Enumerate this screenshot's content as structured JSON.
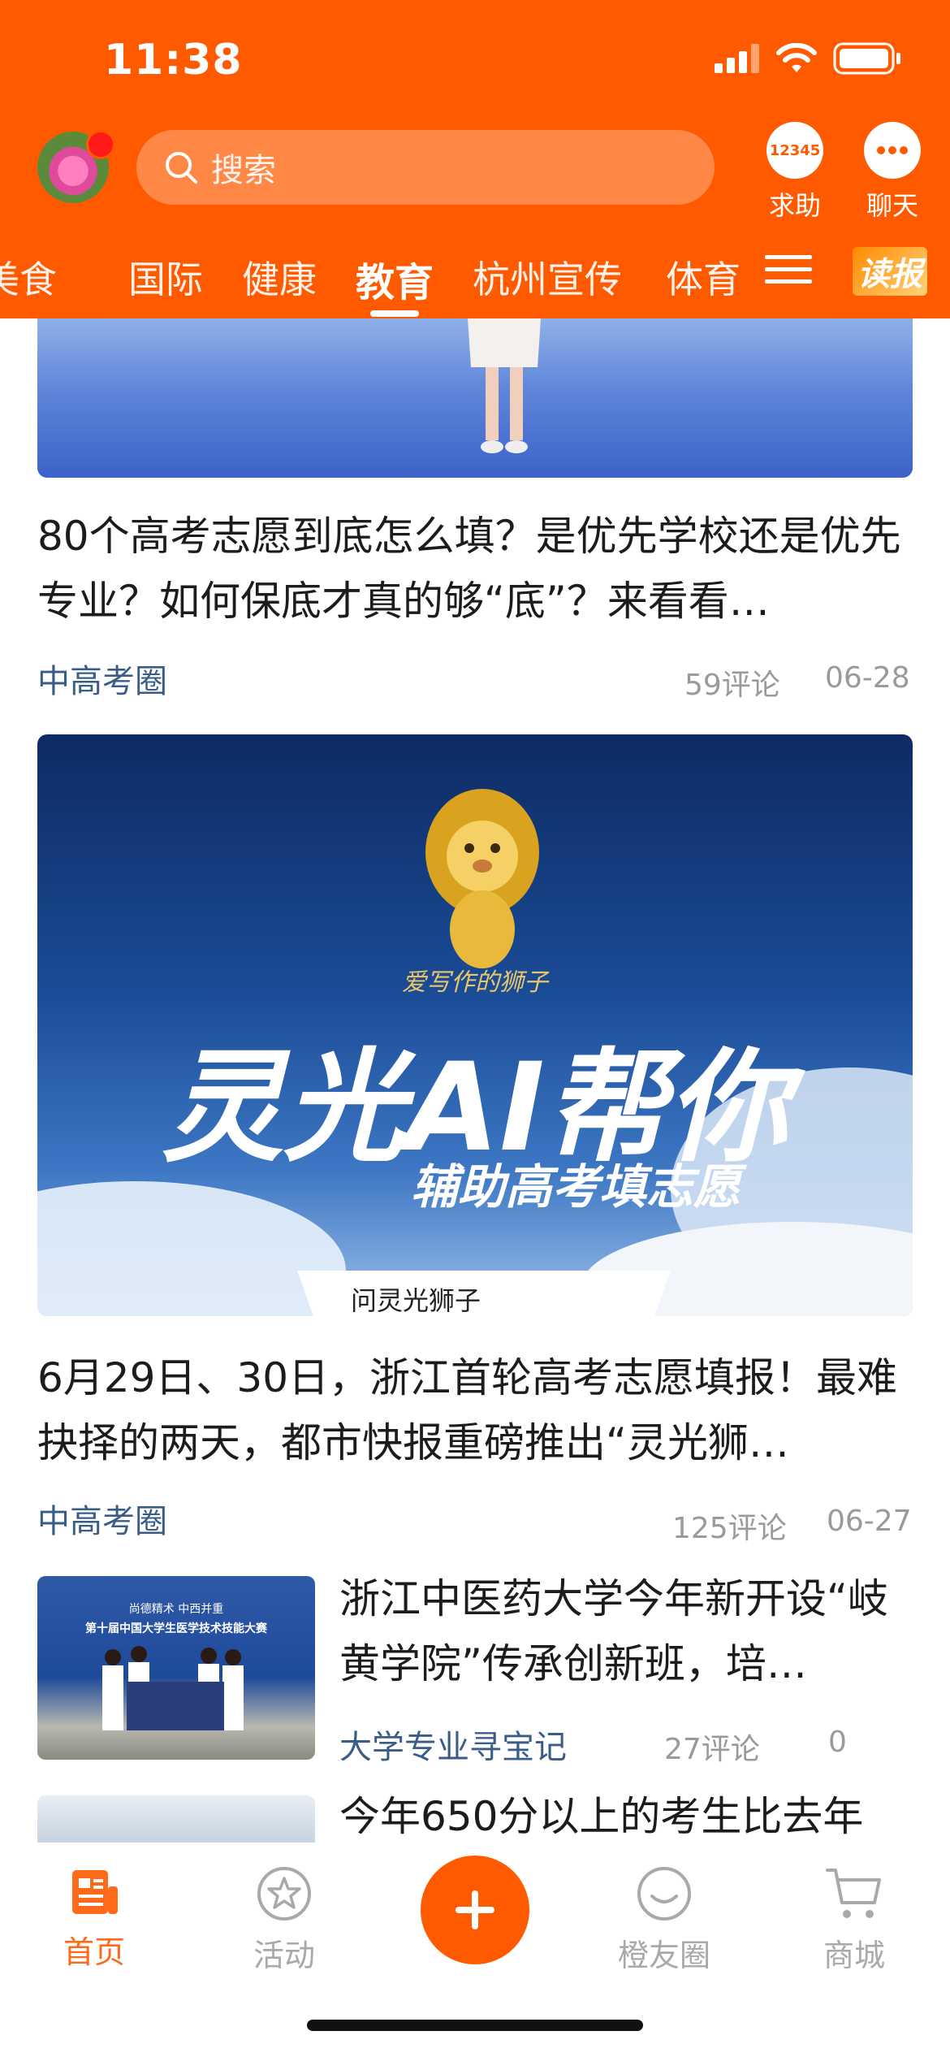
{
  "status": {
    "time": "11:38"
  },
  "header": {
    "search_placeholder": "搜索",
    "help_label": "求助",
    "help_badge": "12345",
    "chat_label": "聊天"
  },
  "tabs": [
    "美食",
    "国际",
    "健康",
    "教育",
    "杭州宣传",
    "体育"
  ],
  "active_tab": "教育",
  "dubao_label": "读报",
  "articles": [
    {
      "title": "80个高考志愿到底怎么填？是优先学校还是优先专业？如何保底才真的够“底”？来看看…",
      "source": "中高考圈",
      "comments": "59评论",
      "date": "06-28"
    },
    {
      "title": "6月29日、30日，浙江首轮高考志愿填报！最难抉择的两天，都市快报重磅推出“灵光狮…",
      "source": "中高考圈",
      "comments": "125评论",
      "date": "06-27",
      "image_text": {
        "brand": "爱写作的狮子",
        "title": "灵光AI帮你",
        "subtitle": "辅助高考填志愿",
        "search_hint": "问灵光狮子"
      }
    },
    {
      "title": "浙江中医药大学今年新开设“岐黄学院”传承创新班，培…",
      "source": "大学专业寻宝记",
      "comments": "27评论",
      "date": "0",
      "thumb_text": {
        "line1": "尚德精术 中西并重",
        "line2": "第十届中国大学生医学技术技能大赛"
      }
    },
    {
      "title": "今年650分以上的考生比去年"
    }
  ],
  "tabbar": {
    "home": "首页",
    "activity": "活动",
    "orange_circle": "橙友圈",
    "mall": "商城"
  }
}
